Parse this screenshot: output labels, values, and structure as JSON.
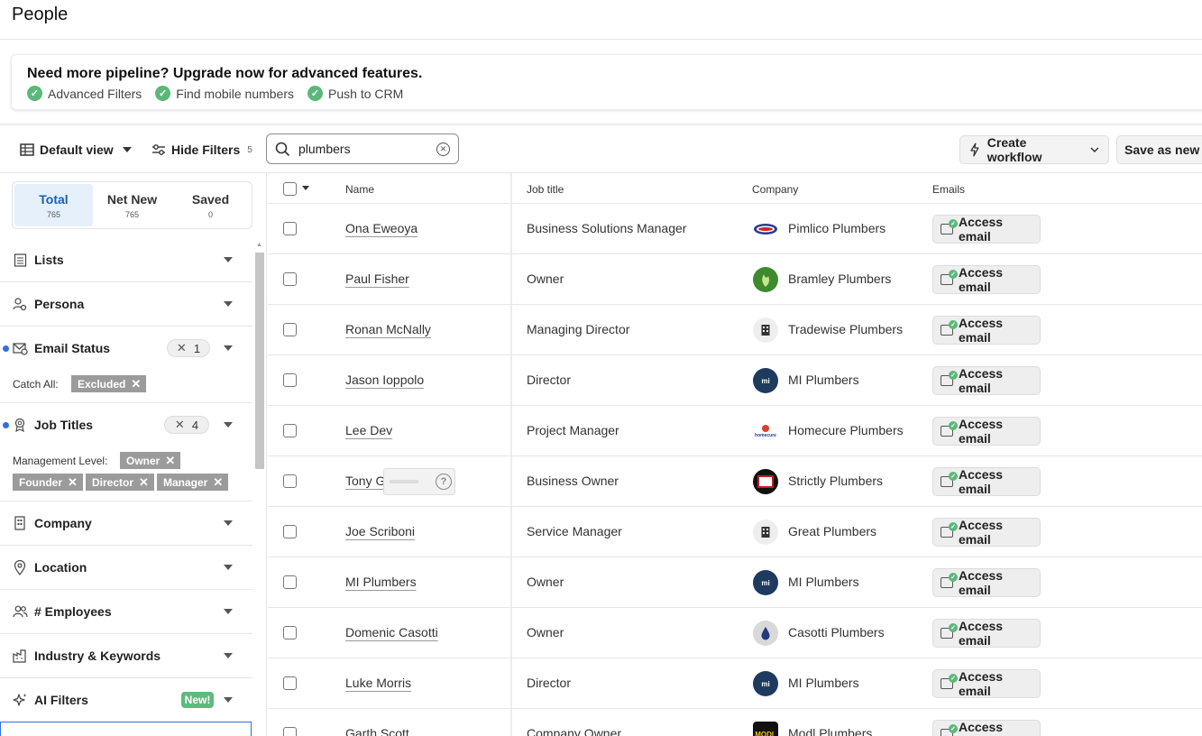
{
  "page": {
    "title": "People"
  },
  "banner": {
    "title": "Need more pipeline? Upgrade now for advanced features.",
    "features": [
      "Advanced Filters",
      "Find mobile numbers",
      "Push to CRM"
    ]
  },
  "toolbar": {
    "view_label": "Default view",
    "hide_filters_label": "Hide Filters",
    "hide_filters_count": "5",
    "search_value": "plumbers",
    "create_workflow_label": "Create workflow",
    "save_as_new_label": "Save as new s"
  },
  "totals": [
    {
      "label": "Total",
      "count": "765",
      "active": true
    },
    {
      "label": "Net New",
      "count": "765",
      "active": false
    },
    {
      "label": "Saved",
      "count": "0",
      "active": false
    }
  ],
  "filters": {
    "lists": {
      "label": "Lists",
      "icon": "list-icon"
    },
    "persona": {
      "label": "Persona",
      "icon": "persona-icon"
    },
    "email_status": {
      "label": "Email Status",
      "icon": "email-status-icon",
      "badge_count": "1",
      "row_label": "Catch All:",
      "chips": [
        "Excluded"
      ]
    },
    "job_titles": {
      "label": "Job Titles",
      "icon": "badge-icon",
      "badge_count": "4",
      "row_label": "Management Level:",
      "chips": [
        "Owner",
        "Founder",
        "Director",
        "Manager"
      ]
    },
    "company": {
      "label": "Company",
      "icon": "building-icon"
    },
    "location": {
      "label": "Location",
      "icon": "location-pin-icon"
    },
    "employees": {
      "label": "# Employees",
      "icon": "people-icon"
    },
    "industry": {
      "label": "Industry & Keywords",
      "icon": "industry-icon"
    },
    "ai_filters": {
      "label": "AI Filters",
      "icon": "sparkle-icon",
      "new_badge": "New!"
    }
  },
  "table": {
    "headers": {
      "name": "Name",
      "job": "Job title",
      "company": "Company",
      "emails": "Emails"
    },
    "email_button_label": "Access email",
    "rows": [
      {
        "name": "Ona Eweoya",
        "job": "Business Solutions Manager",
        "company": "Pimlico Plumbers"
      },
      {
        "name": "Paul Fisher",
        "job": "Owner",
        "company": "Bramley Plumbers"
      },
      {
        "name": "Ronan McNally",
        "job": "Managing Director",
        "company": "Tradewise Plumbers"
      },
      {
        "name": "Jason Ioppolo",
        "job": "Director",
        "company": "MI Plumbers"
      },
      {
        "name": "Lee Dev",
        "job": "Project Manager",
        "company": "Homecure Plumbers"
      },
      {
        "name": "Tony G",
        "job": "Business Owner",
        "company": "Strictly Plumbers"
      },
      {
        "name": "Joe Scriboni",
        "job": "Service Manager",
        "company": "Great Plumbers"
      },
      {
        "name": "MI Plumbers",
        "job": "Owner",
        "company": "MI Plumbers"
      },
      {
        "name": "Domenic Casotti",
        "job": "Owner",
        "company": "Casotti Plumbers"
      },
      {
        "name": "Luke Morris",
        "job": "Director",
        "company": "MI Plumbers"
      },
      {
        "name": "Garth Scott",
        "job": "Company Owner",
        "company": "Modl Plumbers"
      }
    ],
    "logo_labels": {
      "mi": "mi",
      "homecure": "homecure",
      "modl": "MODL"
    }
  }
}
